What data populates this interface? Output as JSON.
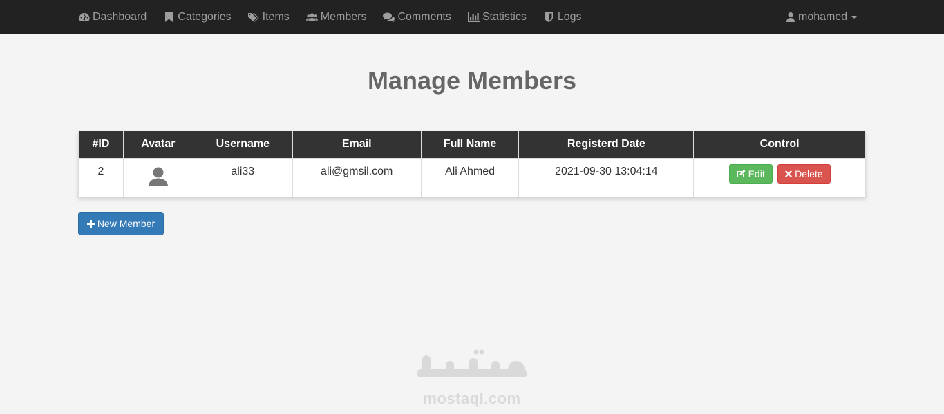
{
  "nav": {
    "items": [
      {
        "label": "Dashboard",
        "icon": "dashboard-icon"
      },
      {
        "label": "Categories",
        "icon": "bookmark-icon"
      },
      {
        "label": "Items",
        "icon": "tags-icon"
      },
      {
        "label": "Members",
        "icon": "users-icon"
      },
      {
        "label": "Comments",
        "icon": "comments-icon"
      },
      {
        "label": "Statistics",
        "icon": "bar-chart-icon"
      },
      {
        "label": "Logs",
        "icon": "shield-icon"
      }
    ],
    "user": {
      "label": "mohamed",
      "icon": "user-icon"
    }
  },
  "page": {
    "title": "Manage Members"
  },
  "table": {
    "headers": [
      "#ID",
      "Avatar",
      "Username",
      "Email",
      "Full Name",
      "Registerd Date",
      "Control"
    ],
    "rows": [
      {
        "id": "2",
        "avatar": "default-avatar-icon",
        "username": "ali33",
        "email": "ali@gmsil.com",
        "full_name": "Ali Ahmed",
        "registered": "2021-09-30 13:04:14",
        "edit_label": "Edit",
        "delete_label": "Delete"
      }
    ]
  },
  "actions": {
    "new_member_label": "New Member"
  },
  "watermark": {
    "text": "mostaql.com"
  },
  "colors": {
    "navbar": "#222222",
    "header": "#333333",
    "edit": "#5cb85c",
    "delete": "#d9534f",
    "primary": "#337ab7"
  }
}
